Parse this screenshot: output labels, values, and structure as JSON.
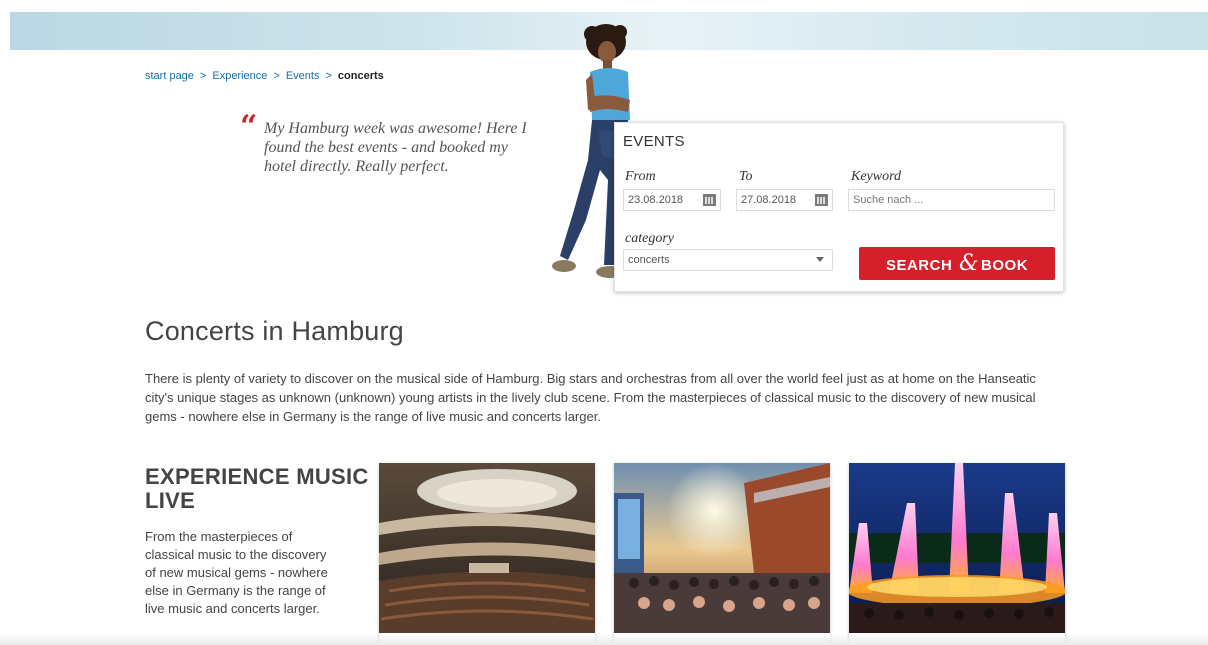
{
  "breadcrumb": {
    "items": [
      "start page",
      "Experience",
      "Events"
    ],
    "current": "concerts",
    "separator": ">"
  },
  "quote": {
    "mark": "“",
    "text": "My Hamburg week was awesome! Here I found the best events - and booked my hotel directly. Really perfect."
  },
  "events": {
    "title": "EVENTS",
    "from_label": "From",
    "from_value": "23.08.2018",
    "to_label": "To",
    "to_value": "27.08.2018",
    "keyword_label": "Keyword",
    "keyword_placeholder": "Suche nach ...",
    "category_label": "category",
    "category_value": "concerts",
    "search_prefix": "SEARCH",
    "search_amp": "&",
    "search_suffix": "BOOK"
  },
  "main": {
    "title": "Concerts in Hamburg",
    "intro": "There is plenty of variety to discover on the musical side of Hamburg. Big stars and orchestras from all over the world feel just as at home on the Hanseatic city's unique stages as unknown (unknown) young artists in the lively club scene. From the masterpieces of classical music to the discovery of new musical gems - nowhere else in Germany is the range of live music and concerts larger."
  },
  "section": {
    "title": "EXPERIENCE MUSIC LIVE",
    "text": "From the masterpieces of classical music to the discovery of new musical gems - nowhere else in Germany is the range of live music and concerts larger."
  },
  "cards": [
    {
      "image": "concert-hall-photo"
    },
    {
      "image": "open-air-crowd-photo"
    },
    {
      "image": "water-light-fountain-photo"
    }
  ],
  "colors": {
    "accent_red": "#d51f2a",
    "link_blue": "#1a6fa8",
    "banner_blue": "#c8e2ea"
  }
}
